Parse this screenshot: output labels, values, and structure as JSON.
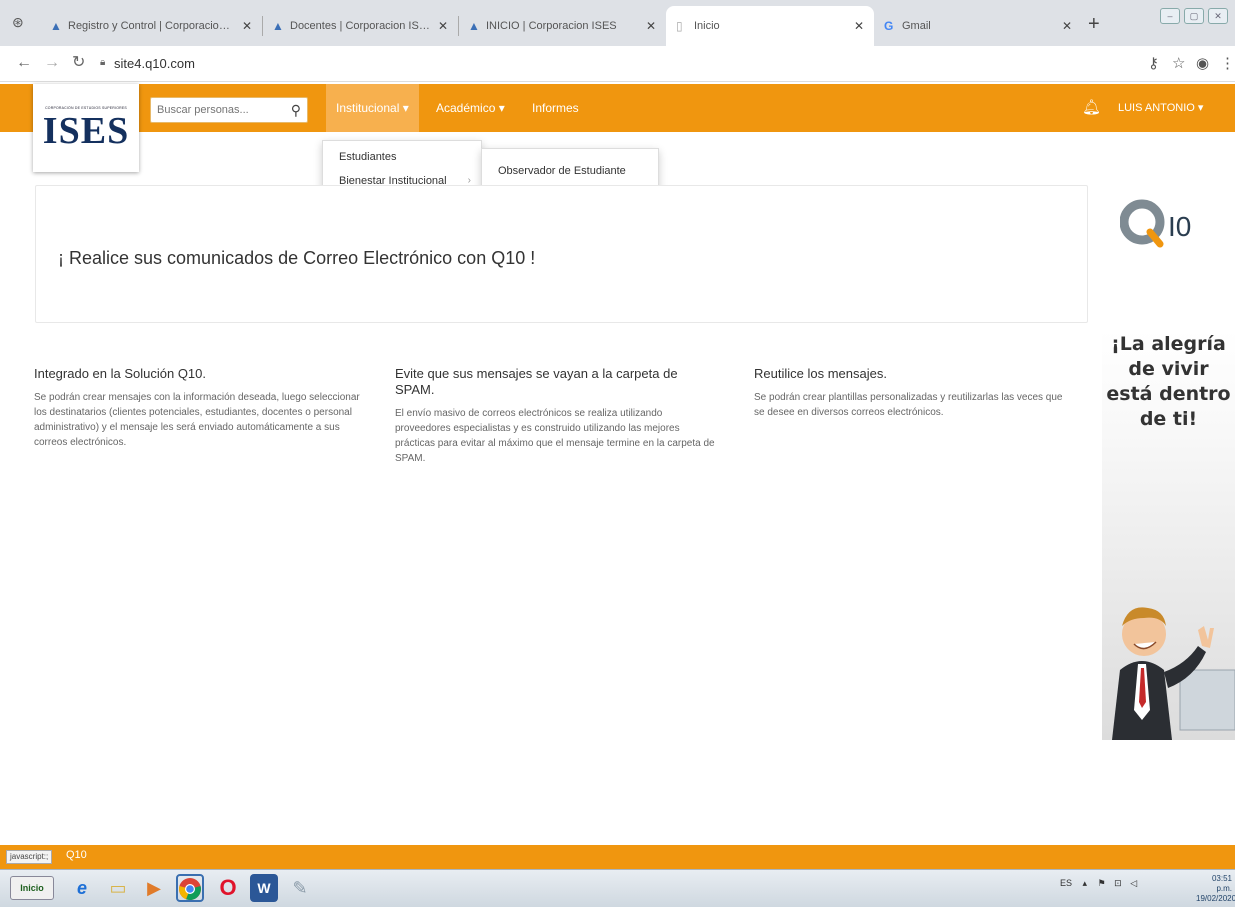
{
  "browser": {
    "tabs": [
      {
        "title": "Registro y Control | Corporacion ISES",
        "close": "✕"
      },
      {
        "title": "Docentes | Corporacion ISES",
        "close": "✕"
      },
      {
        "title": "INICIO | Corporacion ISES",
        "close": "✕"
      },
      {
        "title": "Inicio",
        "close": "✕"
      },
      {
        "title": "Gmail",
        "close": "✕"
      }
    ],
    "url": "site4.q10.com"
  },
  "app": {
    "logo_text": "ISES",
    "logo_small": "CORPORACIÓN DE ESTUDIOS SUPERIORES",
    "search_placeholder": "Buscar personas...",
    "menu": [
      {
        "label": "Institucional ▾"
      },
      {
        "label": "Académico ▾"
      },
      {
        "label": "Informes"
      }
    ],
    "user": "LUIS ANTONIO ▾",
    "dropdown": {
      "items": [
        "Estudiantes",
        "Bienestar Institucional"
      ],
      "sub_items": [
        "Observador de Estudiante"
      ]
    }
  },
  "main": {
    "banner": "¡ Realice sus comunicados de Correo Electrónico con Q10 !",
    "columns": [
      {
        "title": "Integrado en la Solución Q10.",
        "body": "Se podrán crear mensajes con la información deseada, luego seleccionar los destinatarios (clientes potenciales, estudiantes, docentes o personal administrativo) y el mensaje les será enviado automáticamente a sus correos electrónicos."
      },
      {
        "title": "Evite que sus mensajes se vayan a la carpeta de SPAM.",
        "body": "El envío masivo de correos electrónicos se realiza utilizando proveedores especialistas y es construido utilizando las mejores prácticas para evitar al máximo que el mensaje termine en la carpeta de SPAM."
      },
      {
        "title": "Reutilice los mensajes.",
        "body": "Se podrán crear plantillas personalizadas y reutilizarlas las veces que se desee en diversos correos electrónicos."
      }
    ]
  },
  "ad": {
    "brand": "Q10",
    "lines": [
      "¡La alegría",
      "de vivir",
      "está dentro",
      "de ti!"
    ]
  },
  "footer": {
    "text": "Q10",
    "status_tip": "javascript:;"
  },
  "taskbar": {
    "start": "Inicio",
    "lang": "ES",
    "time": "03:51 p.m.",
    "date": "19/02/2020"
  },
  "colors": {
    "accent": "#f0960f",
    "brand_blue": "#14305e"
  }
}
